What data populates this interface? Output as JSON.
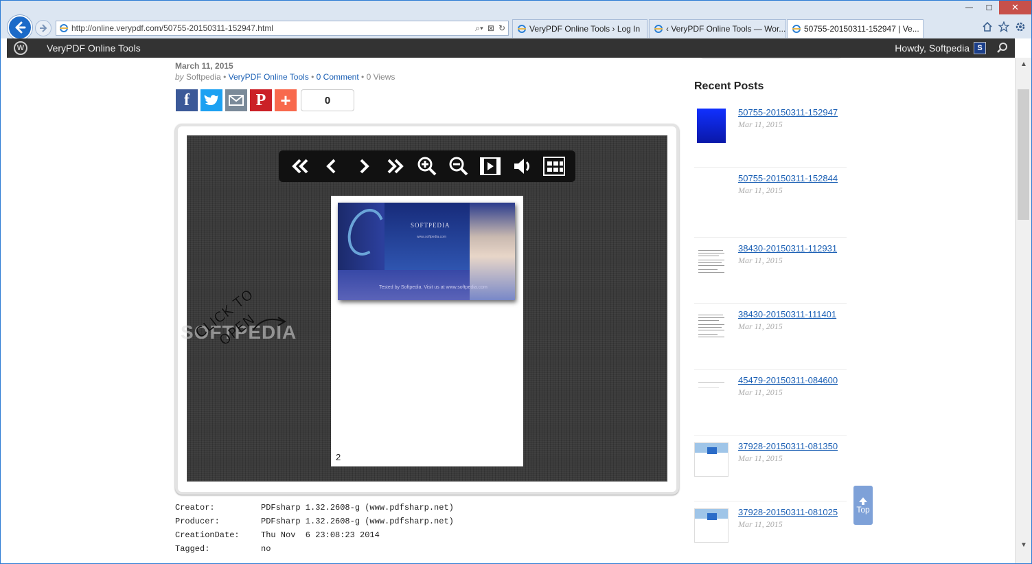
{
  "browser": {
    "url": "http://online.verypdf.com/50755-20150311-152947.html",
    "tabs": [
      {
        "label": "VeryPDF Online Tools › Log In"
      },
      {
        "label": "‹ VeryPDF Online Tools — Wor..."
      },
      {
        "label": "50755-20150311-152947 | Ve..."
      }
    ],
    "window_controls": {
      "minimize": "—",
      "maximize": "☐",
      "close": "✕"
    }
  },
  "adminbar": {
    "site_name": "VeryPDF Online Tools",
    "howdy": "Howdy, Softpedia",
    "avatar_letter": "S",
    "wp_logo": "W"
  },
  "post": {
    "date": "March 11, 2015",
    "by_label": "by",
    "author": "Softpedia",
    "category": "VeryPDF Online Tools",
    "comments": "0 Comment",
    "views": "0 Views",
    "share_count": "0"
  },
  "viewer": {
    "toolbar_icons": [
      "first-page-icon",
      "previous-page-icon",
      "next-page-icon",
      "last-page-icon",
      "zoom-in-icon",
      "zoom-out-icon",
      "slideshow-icon",
      "sound-icon",
      "thumbnails-icon"
    ],
    "click_to_open": "CLICK TO OPEN",
    "page_number": "2",
    "cover": {
      "title": "SOFTPEDIA",
      "subtitle": "www.softpedia.com",
      "footer": "Tested by Softpedia. Visit us at www.softpedia.com"
    },
    "watermark": "SOFTPEDIA"
  },
  "doc_info": [
    {
      "key": "Creator:",
      "value": "PDFsharp 1.32.2608-g (www.pdfsharp.net)"
    },
    {
      "key": "Producer:",
      "value": "PDFsharp 1.32.2608-g (www.pdfsharp.net)"
    },
    {
      "key": "CreationDate:",
      "value": "Thu Nov  6 23:08:23 2014"
    },
    {
      "key": "Tagged:",
      "value": "no"
    }
  ],
  "sidebar": {
    "title": "Recent Posts",
    "posts": [
      {
        "title": "50755-20150311-152947",
        "date": "Mar 11, 2015"
      },
      {
        "title": "50755-20150311-152844",
        "date": "Mar 11, 2015"
      },
      {
        "title": "38430-20150311-112931",
        "date": "Mar 11, 2015"
      },
      {
        "title": "38430-20150311-111401",
        "date": "Mar 11, 2015"
      },
      {
        "title": "45479-20150311-084600",
        "date": "Mar 11, 2015"
      },
      {
        "title": "37928-20150311-081350",
        "date": "Mar 11, 2015"
      },
      {
        "title": "37928-20150311-081025",
        "date": "Mar 11, 2015"
      }
    ]
  },
  "top_button": {
    "label": "Top"
  },
  "colors": {
    "link": "#1a5fb4",
    "adminbar": "#333333",
    "facebook": "#3b5998",
    "twitter": "#1da1f2",
    "email": "#7a8a99",
    "pinterest": "#cb2027",
    "addthis": "#f8694d"
  }
}
